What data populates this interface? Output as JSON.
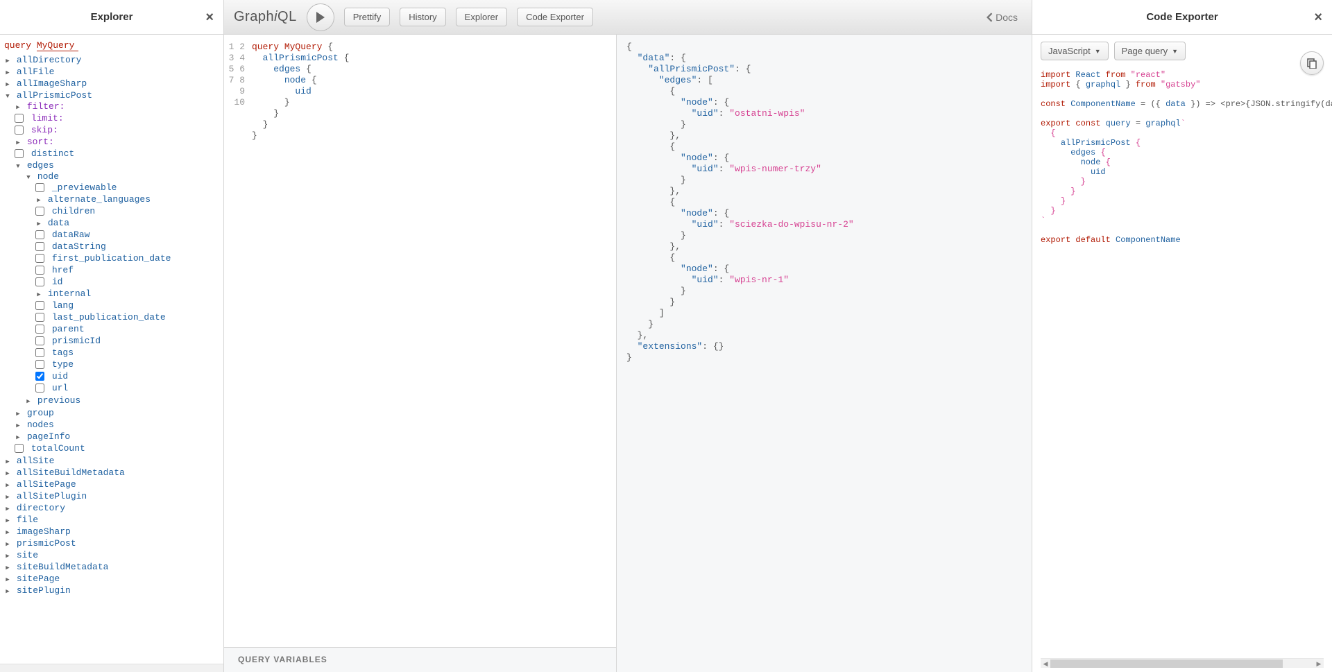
{
  "explorer": {
    "title": "Explorer",
    "query_kw": "query",
    "query_name": "MyQuery",
    "root_items": [
      "allDirectory",
      "allFile",
      "allImageSharp"
    ],
    "expanded": {
      "name": "allPrismicPost",
      "args": [
        {
          "label": "filter:",
          "type": "arg",
          "caret": "closed"
        },
        {
          "label": "limit:",
          "type": "arg",
          "checkbox": true
        },
        {
          "label": "skip:",
          "type": "arg",
          "checkbox": true
        },
        {
          "label": "sort:",
          "type": "arg",
          "caret": "closed"
        },
        {
          "label": "distinct",
          "type": "field",
          "checkbox": true
        }
      ],
      "edges": {
        "label": "edges",
        "node": {
          "label": "node",
          "fields": [
            {
              "label": "_previewable",
              "checkbox": true
            },
            {
              "label": "alternate_languages",
              "caret": "closed"
            },
            {
              "label": "children",
              "checkbox": true
            },
            {
              "label": "data",
              "caret": "closed"
            },
            {
              "label": "dataRaw",
              "checkbox": true
            },
            {
              "label": "dataString",
              "checkbox": true
            },
            {
              "label": "first_publication_date",
              "checkbox": true
            },
            {
              "label": "href",
              "checkbox": true
            },
            {
              "label": "id",
              "checkbox": true
            },
            {
              "label": "internal",
              "caret": "closed"
            },
            {
              "label": "lang",
              "checkbox": true
            },
            {
              "label": "last_publication_date",
              "checkbox": true
            },
            {
              "label": "parent",
              "checkbox": true
            },
            {
              "label": "prismicId",
              "checkbox": true
            },
            {
              "label": "tags",
              "checkbox": true
            },
            {
              "label": "type",
              "checkbox": true
            },
            {
              "label": "uid",
              "checkbox": true,
              "checked": true
            },
            {
              "label": "url",
              "checkbox": true
            }
          ]
        },
        "previous": {
          "label": "previous",
          "caret": "closed"
        }
      },
      "siblings": [
        {
          "label": "group",
          "caret": "closed"
        },
        {
          "label": "nodes",
          "caret": "closed"
        },
        {
          "label": "pageInfo",
          "caret": "closed"
        },
        {
          "label": "totalCount",
          "checkbox": true
        }
      ]
    },
    "root_items_after": [
      "allSite",
      "allSiteBuildMetadata",
      "allSitePage",
      "allSitePlugin",
      "directory",
      "file",
      "imageSharp",
      "prismicPost",
      "site",
      "siteBuildMetadata",
      "sitePage",
      "sitePlugin"
    ]
  },
  "topbar": {
    "logo": "GraphiQL",
    "prettify": "Prettify",
    "history": "History",
    "explorer": "Explorer",
    "code_exporter": "Code Exporter",
    "docs": "Docs"
  },
  "editor": {
    "lines": [
      "1",
      "2",
      "3",
      "4",
      "5",
      "6",
      "7",
      "8",
      "9",
      "10"
    ],
    "code_html": "<span class='kw'>query</span> <span class='def'>MyQuery</span> <span class='punc'>{</span>\n  <span class='fld'>allPrismicPost</span> <span class='punc'>{</span>\n    <span class='fld'>edges</span> <span class='punc'>{</span>\n      <span class='fld'>node</span> <span class='punc'>{</span>\n        <span class='fld'>uid</span>\n      <span class='punc'>}</span>\n    <span class='punc'>}</span>\n  <span class='punc'>}</span>\n<span class='punc'>}</span>\n",
    "query_variables": "QUERY VARIABLES"
  },
  "result": {
    "json_html": "<span class='punc'>{</span>\n  <span class='key'>\"data\"</span><span class='punc'>: {</span>\n    <span class='key'>\"allPrismicPost\"</span><span class='punc'>: {</span>\n      <span class='key'>\"edges\"</span><span class='punc'>: [</span>\n        <span class='punc'>{</span>\n          <span class='key'>\"node\"</span><span class='punc'>: {</span>\n            <span class='key'>\"uid\"</span><span class='punc'>: </span><span class='str'>\"ostatni-wpis\"</span>\n          <span class='punc'>}</span>\n        <span class='punc'>},</span>\n        <span class='punc'>{</span>\n          <span class='key'>\"node\"</span><span class='punc'>: {</span>\n            <span class='key'>\"uid\"</span><span class='punc'>: </span><span class='str'>\"wpis-numer-trzy\"</span>\n          <span class='punc'>}</span>\n        <span class='punc'>},</span>\n        <span class='punc'>{</span>\n          <span class='key'>\"node\"</span><span class='punc'>: {</span>\n            <span class='key'>\"uid\"</span><span class='punc'>: </span><span class='str'>\"sciezka-do-wpisu-nr-2\"</span>\n          <span class='punc'>}</span>\n        <span class='punc'>},</span>\n        <span class='punc'>{</span>\n          <span class='key'>\"node\"</span><span class='punc'>: {</span>\n            <span class='key'>\"uid\"</span><span class='punc'>: </span><span class='str'>\"wpis-nr-1\"</span>\n          <span class='punc'>}</span>\n        <span class='punc'>}</span>\n      <span class='punc'>]</span>\n    <span class='punc'>}</span>\n  <span class='punc'>},</span>\n  <span class='key'>\"extensions\"</span><span class='punc'>: {}</span>\n<span class='punc'>}</span>"
  },
  "exporter": {
    "title": "Code Exporter",
    "lang": "JavaScript",
    "mode": "Page query",
    "code_html": "<span class='kw'>import</span> <span class='mod'>React</span> <span class='kw'>from</span> <span class='str'>\"react\"</span>\n<span class='kw'>import</span> <span class='punc'>{</span> <span class='mod'>graphql</span> <span class='punc'>}</span> <span class='kw'>from</span> <span class='str'>\"gatsby\"</span>\n\n<span class='kw'>const</span> <span class='mod'>ComponentName</span> <span class='punc'>= ({</span> <span class='mod'>data</span> <span class='punc'>}) =&gt; &lt;pre&gt;{JSON.stringify(data, null,</span>\n\n<span class='kw'>export</span> <span class='kw'>const</span> <span class='mod'>query</span> <span class='punc'>=</span> <span class='mod'>graphql</span><span class='str'>`</span>\n  <span class='str'>{</span>\n    <span class='fld'>allPrismicPost</span> <span class='str'>{</span>\n      <span class='fld'>edges</span> <span class='str'>{</span>\n        <span class='fld'>node</span> <span class='str'>{</span>\n          <span class='fld'>uid</span>\n        <span class='str'>}</span>\n      <span class='str'>}</span>\n    <span class='str'>}</span>\n  <span class='str'>}</span>\n<span class='str'>`</span>\n\n<span class='kw'>export</span> <span class='kw'>default</span> <span class='mod'>ComponentName</span>"
  }
}
